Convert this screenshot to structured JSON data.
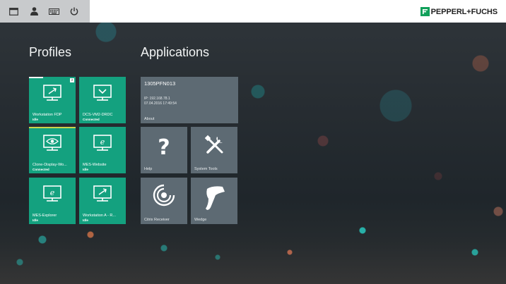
{
  "topbar": {
    "buttons": [
      {
        "name": "window-icon"
      },
      {
        "name": "user-icon"
      },
      {
        "name": "keyboard-icon"
      },
      {
        "name": "power-icon"
      }
    ],
    "brand": "PEPPERL+FUCHS",
    "brand_color": "#10a05a"
  },
  "sections": {
    "profiles": "Profiles",
    "applications": "Applications"
  },
  "profiles": [
    {
      "label": "Workstation FDP",
      "status": "Idle",
      "icon": "remote-desktop-icon",
      "badge": "2"
    },
    {
      "label": "DCS-VM2-DRDC",
      "status": "Connected",
      "icon": "remote-desktop-icon"
    },
    {
      "label": "Clone-Display-Wo...",
      "status": "Connected",
      "icon": "eye-display-icon"
    },
    {
      "label": "MES-Website",
      "status": "Idle",
      "icon": "browser-icon"
    },
    {
      "label": "MES-Explorer",
      "status": "Idle",
      "icon": "browser-icon"
    },
    {
      "label": "Workstation A - R...",
      "status": "Idle",
      "icon": "remote-desktop-icon"
    }
  ],
  "device": {
    "hostname": "1305PFN013",
    "ip": "IP: 192.168.78.1",
    "datetime": "07.04.2016 17:49:54",
    "label": "About"
  },
  "apps": [
    {
      "label": "Help",
      "icon": "question-icon"
    },
    {
      "label": "System Tools",
      "icon": "tools-icon"
    },
    {
      "label": "Citrix Receiver",
      "icon": "citrix-icon"
    },
    {
      "label": "Wedge",
      "icon": "barcode-scanner-icon"
    }
  ],
  "colors": {
    "profile_tile": "#14a17f",
    "app_tile": "#5d6a73"
  }
}
